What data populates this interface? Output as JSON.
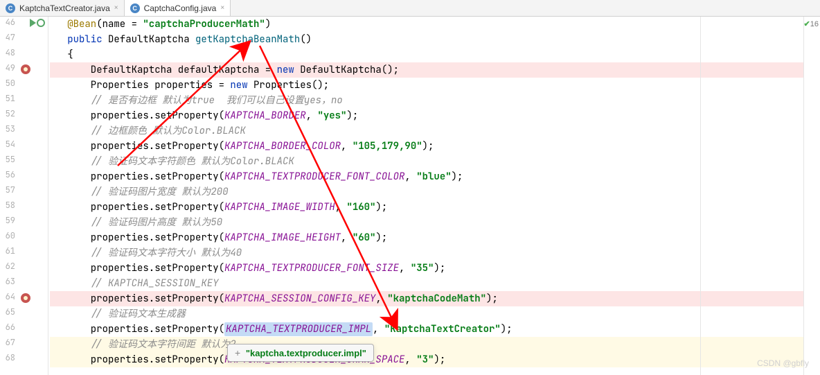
{
  "tabs": [
    {
      "label": "KaptchaTextCreator.java",
      "active": false
    },
    {
      "label": "CaptchaConfig.java",
      "active": true
    }
  ],
  "inspection": {
    "count": "16"
  },
  "gutter": {
    "lines": [
      "46",
      "47",
      "48",
      "49",
      "50",
      "51",
      "52",
      "53",
      "54",
      "55",
      "56",
      "57",
      "58",
      "59",
      "60",
      "61",
      "62",
      "63",
      "64",
      "65",
      "66",
      "67",
      "68"
    ],
    "run_line_index": 0,
    "breakpoints": [
      3,
      18
    ]
  },
  "code": {
    "l0": {
      "anno": "@Bean",
      "plain1": "(name = ",
      "str1": "\"captchaProducerMath\"",
      "plain2": ")"
    },
    "l1": {
      "kw1": "public",
      "plain1": " DefaultKaptcha ",
      "method": "getKaptchaBeanMath",
      "paren": "()"
    },
    "l2": {
      "plain": "{"
    },
    "l3": {
      "plain1": "    DefaultKaptcha defaultKaptcha = ",
      "kw": "new",
      "plain2": " DefaultKaptcha();"
    },
    "l4": {
      "plain1": "    Properties properties = ",
      "kw": "new",
      "plain2": " Properties();"
    },
    "l5": {
      "comment": "    // 是否有边框 默认为true  我们可以自己设置yes，no"
    },
    "l6": {
      "plain1": "    properties.setProperty(",
      "const": "KAPTCHA_BORDER",
      "plain2": ", ",
      "str": "\"yes\"",
      "plain3": ");"
    },
    "l7": {
      "comment": "    // 边框颜色 默认为Color.BLACK"
    },
    "l8": {
      "plain1": "    properties.setProperty(",
      "const": "KAPTCHA_BORDER_COLOR",
      "plain2": ", ",
      "str": "\"105,179,90\"",
      "plain3": ");"
    },
    "l9": {
      "comment": "    // 验证码文本字符颜色 默认为Color.BLACK"
    },
    "l10": {
      "plain1": "    properties.setProperty(",
      "const": "KAPTCHA_TEXTPRODUCER_FONT_COLOR",
      "plain2": ", ",
      "str": "\"blue\"",
      "plain3": ");"
    },
    "l11": {
      "comment": "    // 验证码图片宽度 默认为200"
    },
    "l12": {
      "plain1": "    properties.setProperty(",
      "const": "KAPTCHA_IMAGE_WIDTH",
      "plain2": ", ",
      "str": "\"160\"",
      "plain3": ");"
    },
    "l13": {
      "comment": "    // 验证码图片高度 默认为50"
    },
    "l14": {
      "plain1": "    properties.setProperty(",
      "const": "KAPTCHA_IMAGE_HEIGHT",
      "plain2": ", ",
      "str": "\"60\"",
      "plain3": ");"
    },
    "l15": {
      "comment": "    // 验证码文本字符大小 默认为40"
    },
    "l16": {
      "plain1": "    properties.setProperty(",
      "const": "KAPTCHA_TEXTPRODUCER_FONT_SIZE",
      "plain2": ", ",
      "str": "\"35\"",
      "plain3": ");"
    },
    "l17": {
      "comment": "    // KAPTCHA_SESSION_KEY"
    },
    "l18": {
      "plain1": "    properties.setProperty(",
      "const": "KAPTCHA_SESSION_CONFIG_KEY",
      "plain2": ", ",
      "str": "\"kaptchaCodeMath\"",
      "plain3": ");"
    },
    "l19": {
      "comment": "    // 验证码文本生成器"
    },
    "l20": {
      "plain1": "    properties.setProperty(",
      "const": "KAPTCHA_TEXTPRODUCER_IMPL",
      "plain2": ", ",
      "str": "\"KaptchaTextCreator\"",
      "plain3": ");"
    },
    "l21": {
      "comment": "    // 验证码文本字符间距 默认为2"
    },
    "l22": {
      "plain1": "    properties.setProperty(",
      "const_sel": "K",
      "const_rest": "APTCHA_TEXTPRODUCER_CHAR_SPACE",
      "plain2": ", ",
      "str": "\"3\"",
      "plain3": ");"
    }
  },
  "tooltip": {
    "text": "\"kaptcha.textproducer.impl\""
  },
  "watermark": "CSDN @gbfly"
}
